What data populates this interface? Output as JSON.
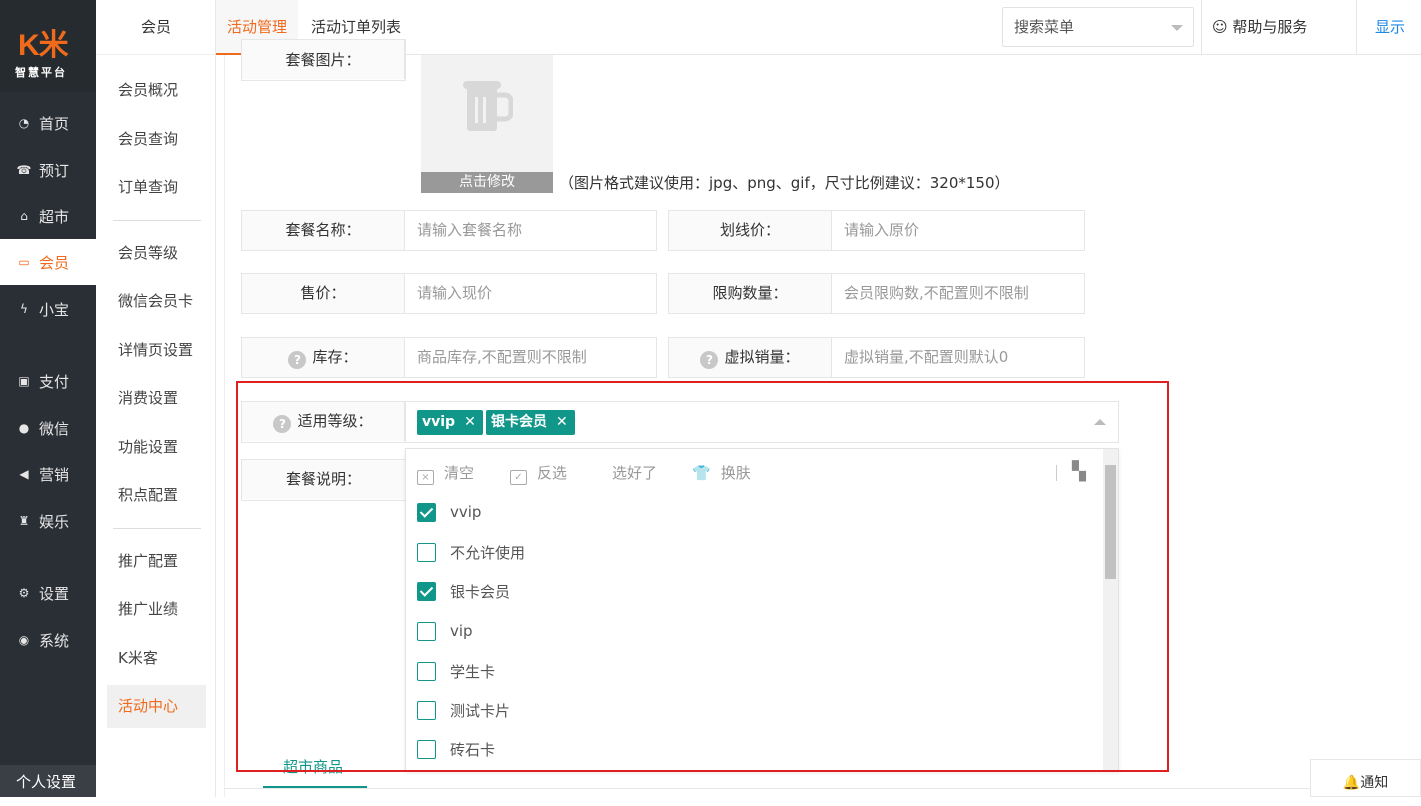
{
  "brand": {
    "logo": "K米",
    "subtitle": "智慧平台"
  },
  "nav": [
    "首页",
    "预订",
    "超市",
    "会员",
    "小宝",
    "支付",
    "微信",
    "营销",
    "娱乐",
    "设置",
    "系统"
  ],
  "nav_active": "会员",
  "personal": "个人设置",
  "submenu": {
    "title": "会员",
    "items": [
      "会员概况",
      "会员查询",
      "订单查询",
      "会员等级",
      "微信会员卡",
      "详情页设置",
      "消费设置",
      "功能设置",
      "积点配置",
      "推广配置",
      "推广业绩",
      "K米客",
      "活动中心"
    ]
  },
  "tabs": [
    "活动管理",
    "活动订单列表"
  ],
  "search": "搜索菜单",
  "help": "帮助与服务",
  "show": "显示",
  "form": {
    "image_label": "套餐图片：",
    "image_edit": "点击修改",
    "image_hint": "（图片格式建议使用：jpg、png、gif，尺寸比例建议：320*150）",
    "name_label": "套餐名称：",
    "name_ph": "请输入套餐名称",
    "orig_label": "划线价：",
    "orig_ph": "请输入原价",
    "price_label": "售价：",
    "price_ph": "请输入现价",
    "limit_label": "限购数量：",
    "limit_ph": "会员限购数,不配置则不限制",
    "stock_label": "库存：",
    "stock_ph": "商品库存,不配置则不限制",
    "vsales_label": "虚拟销量：",
    "vsales_ph": "虚拟销量,不配置则默认0",
    "level_label": "适用等级：",
    "desc_label": "套餐说明："
  },
  "selected_tags": [
    "vvip",
    "银卡会员"
  ],
  "toolbar": {
    "clear": "清空",
    "invert": "反选",
    "done": "选好了",
    "skin": "换肤"
  },
  "options": [
    {
      "label": "vvip",
      "checked": true
    },
    {
      "label": "不允许使用",
      "checked": false
    },
    {
      "label": "银卡会员",
      "checked": true
    },
    {
      "label": "vip",
      "checked": false
    },
    {
      "label": "学生卡",
      "checked": false
    },
    {
      "label": "测试卡片",
      "checked": false
    },
    {
      "label": "砖石卡",
      "checked": false
    }
  ],
  "bottom_tab": "超市商品",
  "notify": "通知",
  "colors": {
    "accent": "#f06a1c",
    "teal": "#11968a",
    "highlight": "#e02020"
  }
}
